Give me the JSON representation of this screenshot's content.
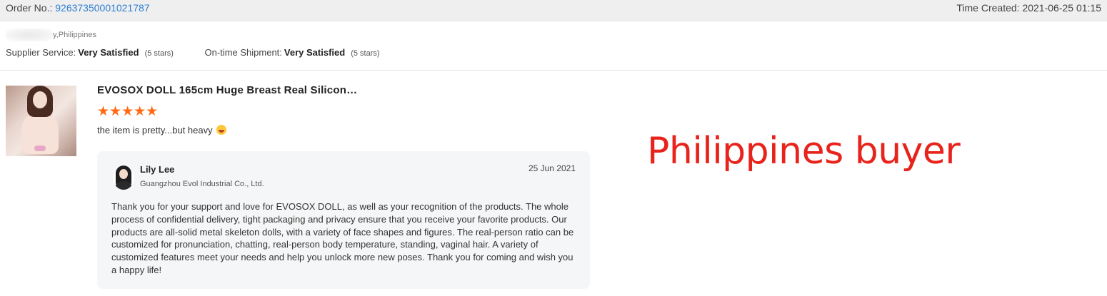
{
  "order": {
    "number_label": "Order No.:",
    "number_value": "92637350001021787",
    "time_label": "Time Created:",
    "time_value": "2021-06-25 01:15"
  },
  "buyer": {
    "location_suffix": "y,Philippines"
  },
  "ratings": {
    "supplier_label": "Supplier Service:",
    "supplier_value": "Very Satisfied",
    "supplier_stars": "(5 stars)",
    "shipment_label": "On-time Shipment:",
    "shipment_value": "Very Satisfied",
    "shipment_stars": "(5 stars)"
  },
  "review": {
    "product_title": "EVOSOX DOLL 165cm Huge Breast Real Silicon…",
    "stars": "★★★★★",
    "star_count": 5,
    "text": "the item is pretty...but heavy",
    "star_color": "#ff6a13"
  },
  "reply": {
    "seller_name": "Lily Lee",
    "company": "Guangzhou Evol Industrial Co., Ltd.",
    "date": "25 Jun 2021",
    "body": "Thank you for your support and love for EVOSOX DOLL, as well as your recognition of the products. The whole process of confidential delivery, tight packaging and privacy ensure that you receive your favorite products. Our products are all-solid metal skeleton dolls, with a variety of face shapes and figures. The real-person ratio can be customized for pronunciation, chatting, real-person body temperature, standing, vaginal hair. A variety of customized features meet your needs and help you unlock more new poses. Thank you for coming and wish you a happy life!"
  },
  "annotation": {
    "text": "Philippines buyer",
    "color": "#e8231c"
  },
  "colors": {
    "link": "#2d7fd2",
    "header_bg": "#efefef",
    "reply_bg": "#f5f6f7"
  }
}
